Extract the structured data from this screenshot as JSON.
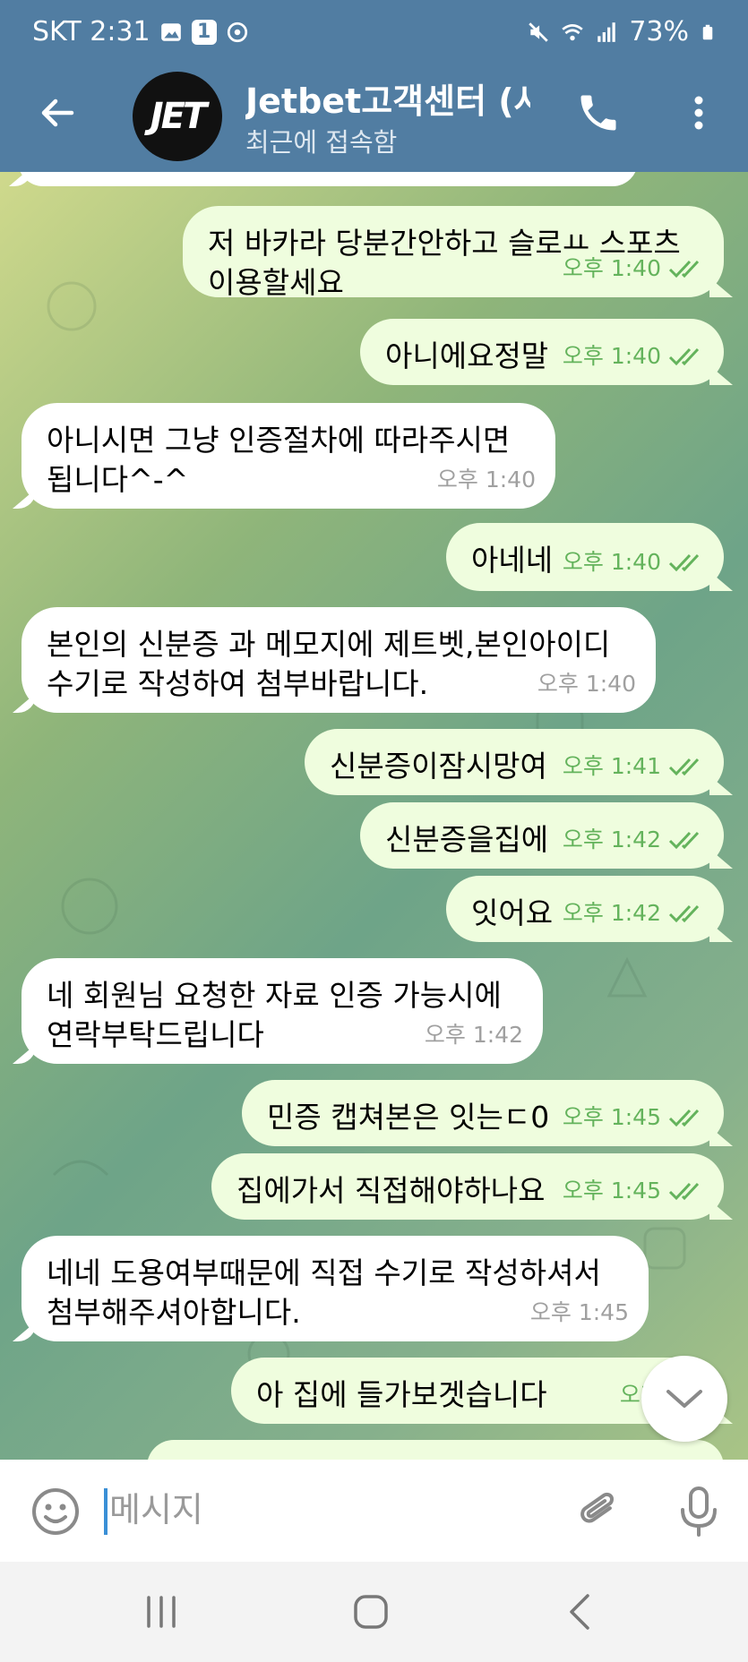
{
  "status_bar": {
    "carrier_time": "SKT 2:31",
    "notification_badge": "1",
    "battery": "73%"
  },
  "header": {
    "avatar_text": "JET",
    "title": "Jetbet고객센터 (사칭",
    "subtitle": "최근에 접속함"
  },
  "messages": [
    {
      "dir": "out",
      "text": "저 바카라 당분간안하고 슬로ㅛ 스포츠\n이용할세요",
      "time": "오후 1:40"
    },
    {
      "dir": "out",
      "text": "아니에요정말",
      "time": "오후 1:40"
    },
    {
      "dir": "in",
      "text": "아니시면 그냥 인증절차에 따라주시면\n됩니다^-^",
      "time": "오후 1:40"
    },
    {
      "dir": "out",
      "text": "아네네",
      "time": "오후 1:40"
    },
    {
      "dir": "in",
      "text": "본인의 신분증 과 메모지에 제트벳,본인아이디\n수기로 작성하여 첨부바랍니다.",
      "time": "오후 1:40"
    },
    {
      "dir": "out",
      "text": "신분증이잠시망여",
      "time": "오후 1:41"
    },
    {
      "dir": "out",
      "text": "신분증을집에",
      "time": "오후 1:42"
    },
    {
      "dir": "out",
      "text": "잇어요",
      "time": "오후 1:42"
    },
    {
      "dir": "in",
      "text": "네 회원님 요청한 자료 인증 가능시에\n연락부탁드립니다",
      "time": "오후 1:42"
    },
    {
      "dir": "out",
      "text": "민증 캡쳐본은 잇는ㄷ0",
      "time": "오후 1:45"
    },
    {
      "dir": "out",
      "text": "집에가서 직접해야하나요",
      "time": "오후 1:45"
    },
    {
      "dir": "in",
      "text": "네네 도용여부때문에 직접 수기로 작성하셔서\n첨부해주셔아합니다.",
      "time": "오후 1:45"
    },
    {
      "dir": "out",
      "text": "아 집에 들가보겟습니다",
      "time": "오후 1:4"
    }
  ],
  "input": {
    "placeholder": "메시지"
  },
  "colors": {
    "header": "#517da2",
    "bubble_in": "#ffffff",
    "bubble_out": "#effdde",
    "time_out": "#64b35c"
  },
  "icons": [
    "back-arrow-icon",
    "phone-icon",
    "more-vertical-icon",
    "emoji-icon",
    "attach-icon",
    "mic-icon",
    "chevron-down-icon",
    "double-check-icon"
  ]
}
